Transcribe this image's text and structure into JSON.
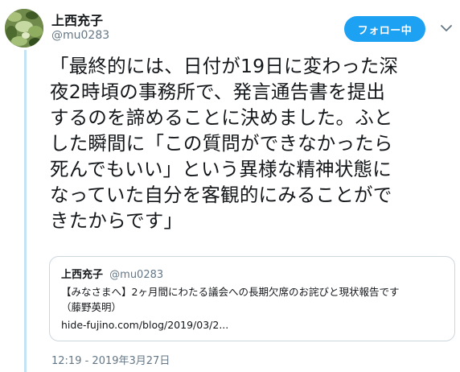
{
  "author": {
    "name": "上西充子",
    "handle": "@mu0283"
  },
  "follow_button": {
    "label": "フォロー中"
  },
  "menu": {
    "icon": "chevron-down-icon"
  },
  "tweet": {
    "lines": [
      "「最終的には、日付が19日に変わった深",
      "夜2時頃の事務所で、発言通告書を提出",
      "するのを諦めることに決めました。ふと",
      "した瞬間に「この質問ができなかったら",
      "死んでもいい」という異様な精神状態に",
      "なっていた自分を客観的にみることがで",
      "きたからです」"
    ]
  },
  "quote": {
    "name": "上西充子",
    "handle": "@mu0283",
    "body_lines": [
      "【みなさまへ】2ヶ月間にわたる議会への長期欠席のお詫びと現状報告です",
      "（藤野英明）"
    ],
    "url": "hide-fujino.com/blog/2019/03/2..."
  },
  "timestamp": "12:19 - 2019年3月27日",
  "colors": {
    "accent": "#1da1f2",
    "thread_line": "#c4e4f5",
    "secondary_text": "#657786",
    "border": "#ccd6dd"
  }
}
